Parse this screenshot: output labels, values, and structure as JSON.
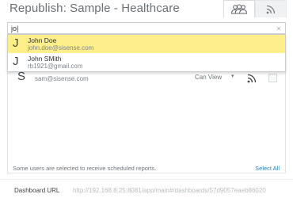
{
  "dialog": {
    "title": "Republish: Sample - Healthcare",
    "tabs": [
      {
        "name": "users",
        "icon": "users-icon",
        "active": true
      },
      {
        "name": "subscriptions",
        "icon": "rss-icon",
        "active": false
      }
    ]
  },
  "search": {
    "value": "jo|",
    "placeholder": "",
    "clear_label": "×"
  },
  "suggestions": [
    {
      "initial": "J",
      "name": "John Doe",
      "email": "john.doe@sisense.com",
      "highlighted": true
    },
    {
      "initial": "J",
      "name": "John SMith",
      "email": "rb1921@gmail.com",
      "highlighted": false
    }
  ],
  "shared_users": [
    {
      "initial": "S",
      "email": "sam@sisense.com",
      "permission": "Can View",
      "caret": "▾"
    }
  ],
  "footer": {
    "note": "Some users are selected to receive scheduled reports.",
    "select_all": "Select All"
  },
  "url": {
    "label": "Dashboard URL",
    "value": "http://192.168.8.25:8081/app/main#/dashboards/57d9057eaeb86020"
  },
  "colors": {
    "highlight": "#ffef8a",
    "link": "#1f7fd1"
  }
}
